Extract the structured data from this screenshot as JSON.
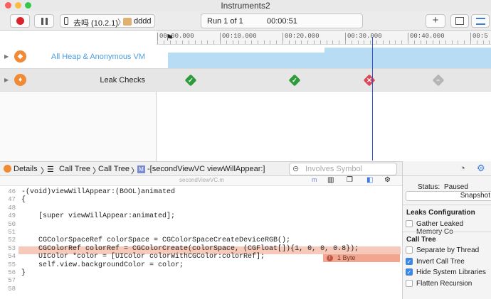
{
  "window": {
    "title": "Instruments2"
  },
  "toolbar": {
    "device_label": "去吗 (10.2.1)",
    "target_label": "dddd",
    "run_label": "Run 1 of 1",
    "elapsed_time": "00:00:51"
  },
  "ruler": {
    "ticks": [
      "00:00.000",
      "00:10.000",
      "00:20.000",
      "00:30.000",
      "00:40.000",
      "00:5"
    ]
  },
  "tracks": [
    {
      "label": "All Heap & Anonymous VM",
      "color": "#4a9ee0"
    },
    {
      "label": "Leak Checks",
      "color": "#222222"
    }
  ],
  "leak_marks": [
    {
      "time_s": 5.5,
      "status": "ok"
    },
    {
      "time_s": 22,
      "status": "ok"
    },
    {
      "time_s": 34,
      "status": "leak"
    },
    {
      "time_s": 45,
      "status": "pending"
    }
  ],
  "pathbar": {
    "items": [
      "Details",
      "Call Tree",
      "Call Tree",
      "-[secondViewVC viewWillAppear:]"
    ],
    "method_badge": "M",
    "search_placeholder": "Involves Symbol"
  },
  "source_file": "secondViewVC.m",
  "source_lang_badge": "m",
  "code_lines": [
    {
      "num": "46",
      "text": "-(void)viewWillAppear:(BOOL)animated"
    },
    {
      "num": "47",
      "text": "{"
    },
    {
      "num": "48",
      "text": ""
    },
    {
      "num": "49",
      "text": "    [super viewWillAppear:animated];"
    },
    {
      "num": "50",
      "text": ""
    },
    {
      "num": "51",
      "text": ""
    },
    {
      "num": "52",
      "text": "    CGColorSpaceRef colorSpace = CGColorSpaceCreateDeviceRGB();"
    },
    {
      "num": "53",
      "text": "    CGColorRef colorRef = CGColorCreate(colorSpace, (CGFloat[]){1, 0, 0, 0.8});"
    },
    {
      "num": "54",
      "text": "    UIColor *color = [UIColor colorWithCGColor:colorRef];"
    },
    {
      "num": "55",
      "text": "    self.view.backgroundColor = color;"
    },
    {
      "num": "56",
      "text": "}"
    },
    {
      "num": "57",
      "text": ""
    },
    {
      "num": "58",
      "text": ""
    }
  ],
  "leak_badge": "1 Byte",
  "inspector": {
    "status_label": "Status:",
    "status_value": "Paused",
    "snapshot_button": "Snapshot",
    "leaks_config_header": "Leaks Configuration",
    "gather_label": "Gather Leaked Memory Co",
    "call_tree_header": "Call Tree",
    "options": [
      {
        "label": "Separate by Thread",
        "checked": false
      },
      {
        "label": "Invert Call Tree",
        "checked": true
      },
      {
        "label": "Hide System Libraries",
        "checked": true
      },
      {
        "label": "Flatten Recursion",
        "checked": false
      }
    ]
  }
}
